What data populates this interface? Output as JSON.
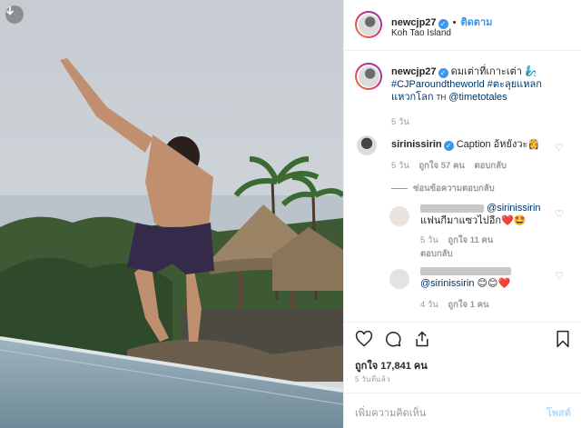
{
  "header": {
    "username": "newcjp27",
    "follow_label": "ติดตาม",
    "location": "Koh Tao Island"
  },
  "caption": {
    "username": "newcjp27",
    "line1": "ดมเต่าที่เกาะเต่า 🧞‍♂️",
    "line2": "#CJParoundtheworld #ตะลุยแหลก",
    "line3_a": "แหวกโลก",
    "line3_tag": "TH",
    "line3_mention": "@timetotales",
    "time": "5 วัน"
  },
  "comments": [
    {
      "username": "sirinissirin",
      "text": "Caption อ้หยังวะ👸",
      "time": "5 วัน",
      "likes": "ถูกใจ 57 คน",
      "reply_label": "ตอบกลับ",
      "hide_replies": "ซ่อนข้อความตอบกลับ"
    },
    {
      "mention": "@sirinissirin",
      "text": "แฟนกีมาแซวไปอีก❤️🤩",
      "time": "5 วัน",
      "likes": "ถูกใจ 11 คน",
      "reply_label": "ตอบกลับ"
    },
    {
      "mention": "@sirinissirin",
      "text": "😊😊❤️",
      "time": "4 วัน",
      "likes": "ถูกใจ 1 คน"
    }
  ],
  "actions": {
    "likes": "ถูกใจ 17,841 คน",
    "date": "5 วันที่แล้ว"
  },
  "add_comment": {
    "placeholder": "เพิ่มความคิดเห็น",
    "post_label": "โพสต์"
  },
  "icons": {
    "download": "download-icon",
    "heart": "heart-icon",
    "comment": "comment-icon",
    "share": "share-icon",
    "bookmark": "bookmark-icon"
  },
  "colors": {
    "link_blue": "#3897f0",
    "hashtag": "#003569",
    "heart_red": "#ed4956"
  }
}
